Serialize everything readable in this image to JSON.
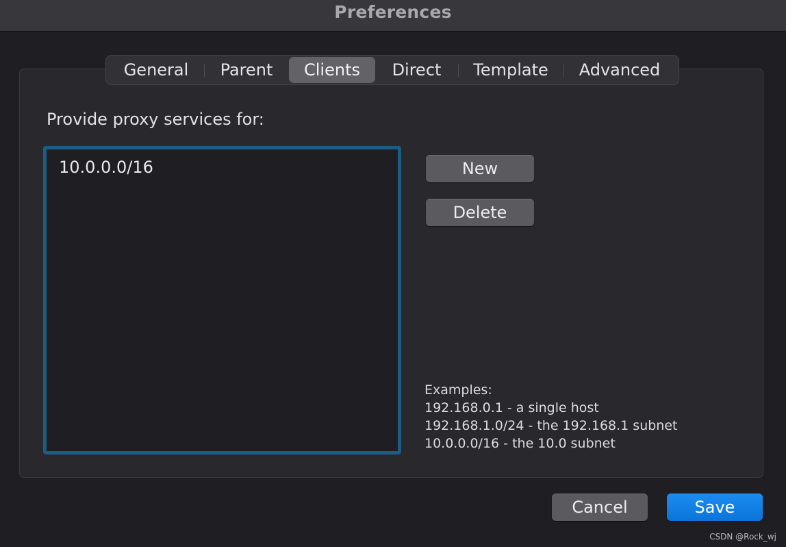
{
  "window": {
    "title": "Preferences"
  },
  "tabs": [
    {
      "label": "General",
      "active": false
    },
    {
      "label": "Parent",
      "active": false
    },
    {
      "label": "Clients",
      "active": true
    },
    {
      "label": "Direct",
      "active": false
    },
    {
      "label": "Template",
      "active": false
    },
    {
      "label": "Advanced",
      "active": false
    }
  ],
  "clients": {
    "label": "Provide proxy services for:",
    "items": [
      "10.0.0.0/16"
    ],
    "new_label": "New",
    "delete_label": "Delete",
    "examples": {
      "heading": "Examples:",
      "lines": [
        "192.168.0.1 - a single host",
        "192.168.1.0/24 - the 192.168.1 subnet",
        "10.0.0.0/16 - the 10.0 subnet"
      ]
    }
  },
  "footer": {
    "cancel_label": "Cancel",
    "save_label": "Save"
  },
  "watermark": "CSDN @Rock_wj",
  "colors": {
    "accent": "#0a84ff",
    "list_focus_border": "#1b5e85",
    "window_bg": "#1f1e23",
    "panel_bg": "#29282d"
  }
}
